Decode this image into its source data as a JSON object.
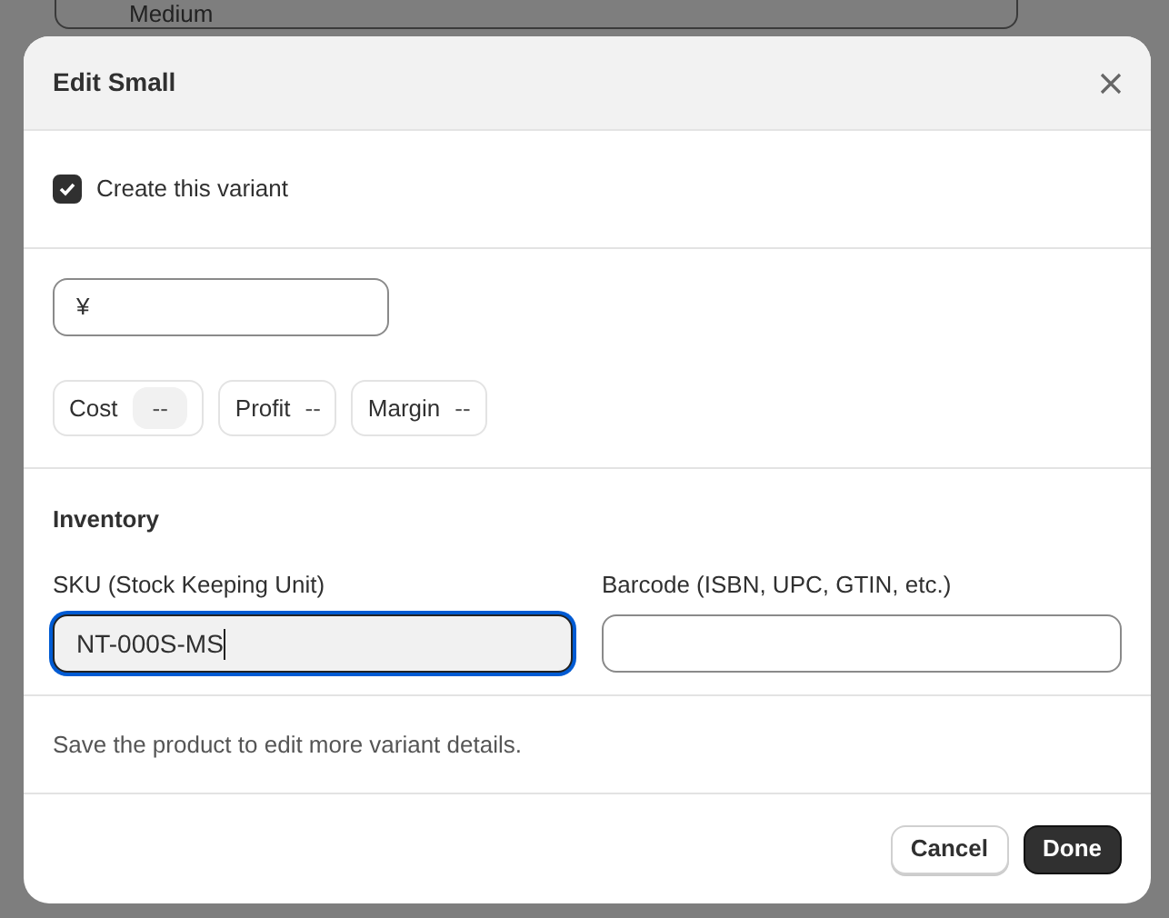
{
  "background": {
    "field_value": "Medium"
  },
  "dialog": {
    "title": "Edit Small",
    "create_variant": {
      "label": "Create this variant",
      "checked": true
    },
    "price": {
      "prefix": "¥"
    },
    "metrics": [
      {
        "label": "Cost",
        "value": "--",
        "kind": "field"
      },
      {
        "label": "Profit",
        "value": "--",
        "kind": "text"
      },
      {
        "label": "Margin",
        "value": "--",
        "kind": "text"
      }
    ],
    "inventory": {
      "title": "Inventory",
      "sku": {
        "label": "SKU (Stock Keeping Unit)",
        "value": "NT-000S-MS",
        "focused": true
      },
      "barcode": {
        "label": "Barcode (ISBN, UPC, GTIN, etc.)",
        "focused": false
      }
    },
    "note": "Save the product to edit more variant details.",
    "buttons": [
      {
        "label": "Cancel",
        "kind": "secondary"
      },
      {
        "label": "Done",
        "kind": "primary"
      }
    ]
  }
}
